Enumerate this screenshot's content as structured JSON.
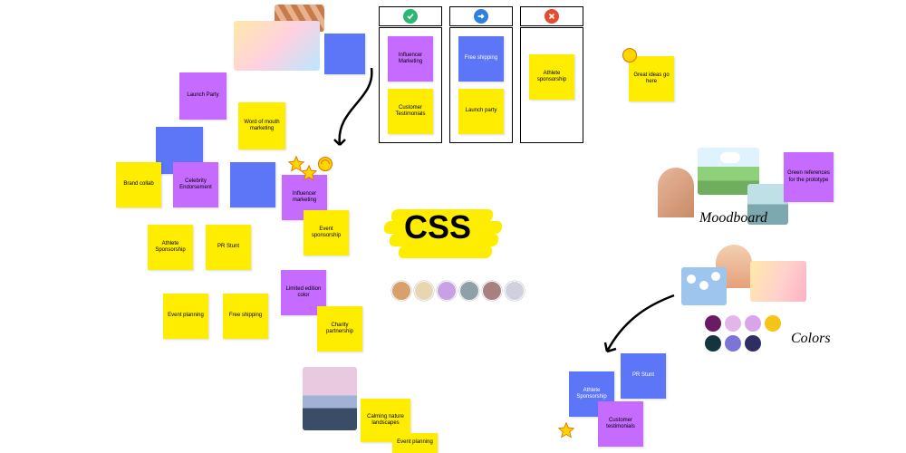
{
  "notes": {
    "launch_party": "Launch Party",
    "word_of_mouth": "Word of mouth marketing",
    "brand_collab": "Brand collab",
    "celebrity": "Celebrity Endorsement",
    "influencer": "Influencer marketing",
    "event_sponsorship": "Event sponsorship",
    "athlete_sponsorship": "Athlete Sponsorship",
    "pr_stunt": "PR Stunt",
    "event_planning": "Event planning",
    "free_shipping": "Free shipping",
    "limited_color": "Limited edition color",
    "charity": "Charity partnership",
    "calming_nature": "Calming nature landscapes",
    "event_planning_2": "Event planning",
    "great_ideas": "Great ideas go here",
    "green_refs": "Green references for the prototype",
    "pr_stunt_2": "PR Stunt",
    "athlete_sponsorship_2": "Athlete Sponsorship",
    "customer_testimonials_2": "Customer testimonials"
  },
  "columns": {
    "c1_influencer": "Influencer Marketing",
    "c1_customer": "Customer Testimonials",
    "c2_free_shipping": "Free shipping",
    "c2_launch_party": "Launch party",
    "c3_athlete": "Athlete sponsorship"
  },
  "title": "CSS",
  "labels": {
    "moodboard": "Moodboard",
    "colors": "Colors"
  },
  "palette": {
    "c1": "#6b1b63",
    "c2": "#e2b6e8",
    "c3": "#d8a4ea",
    "c4": "#f6c419",
    "c5": "#14353d",
    "c6": "#7a75d6",
    "c7": "#2f2e63"
  },
  "note_colors": {
    "yellow": "#ffed00",
    "violet": "#c56bff",
    "blue": "#5d76f7"
  },
  "avatars": [
    {
      "bg": "#d9a06b"
    },
    {
      "bg": "#e8d6b0"
    },
    {
      "bg": "#c8a0e6"
    },
    {
      "bg": "#8fa0a8"
    },
    {
      "bg": "#a88080"
    },
    {
      "bg": "#d0d0e0"
    }
  ],
  "status": {
    "approve": "#2bb673",
    "info": "#2e7fe0",
    "reject": "#e54b2e"
  }
}
